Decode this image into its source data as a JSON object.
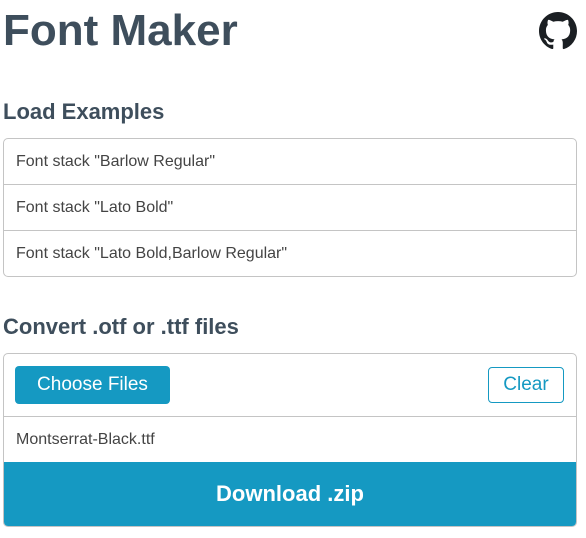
{
  "header": {
    "title": "Font Maker",
    "github_icon": "github-icon"
  },
  "examples": {
    "heading": "Load Examples",
    "items": [
      "Font stack \"Barlow Regular\"",
      "Font stack \"Lato Bold\"",
      "Font stack \"Lato Bold,Barlow Regular\""
    ]
  },
  "convert": {
    "heading": "Convert .otf or .ttf files",
    "choose_label": "Choose Files",
    "clear_label": "Clear",
    "files": [
      "Montserrat-Black.ttf"
    ],
    "download_label": "Download .zip"
  },
  "colors": {
    "accent": "#1599c2",
    "text": "#3e4e5c",
    "border": "#c4c4c4"
  }
}
